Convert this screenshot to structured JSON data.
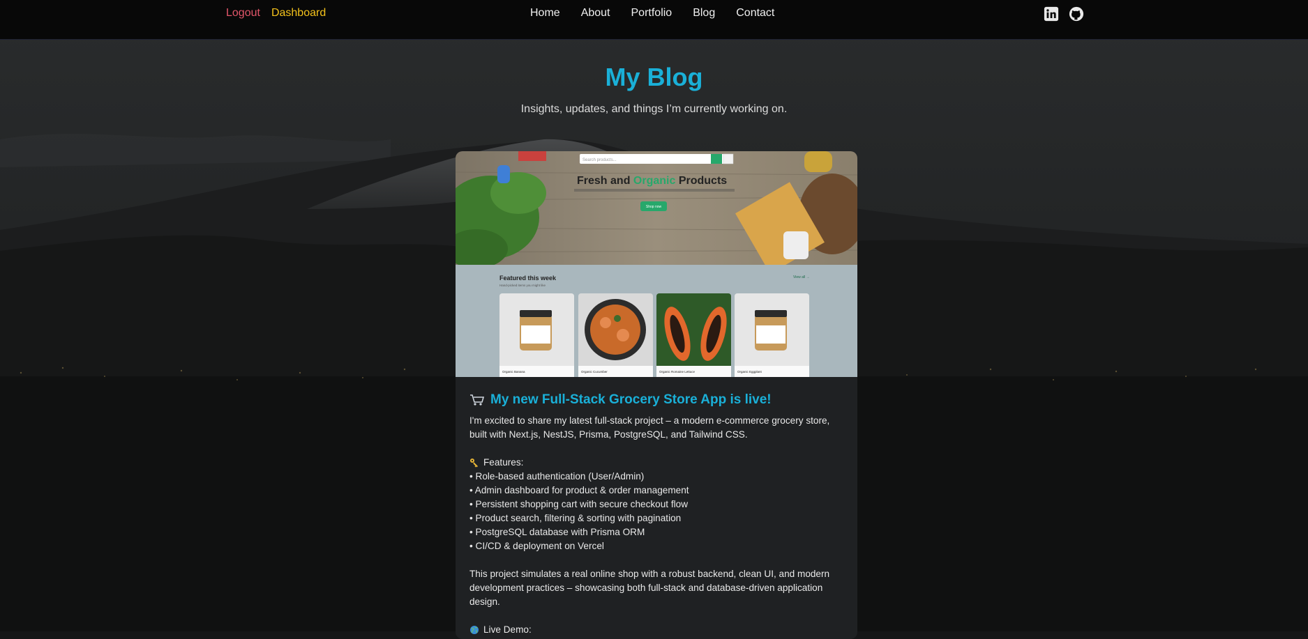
{
  "header": {
    "auth_links": {
      "logout": "Logout",
      "dashboard": "Dashboard"
    },
    "nav": [
      "Home",
      "About",
      "Portfolio",
      "Blog",
      "Contact"
    ],
    "social_icons": [
      "linkedin-icon",
      "github-icon"
    ]
  },
  "page": {
    "title": "My Blog",
    "subtitle": "Insights, updates, and things I’m currently working on."
  },
  "post": {
    "screenshot": {
      "search_placeholder": "Search products...",
      "hero_title_part1": "Fresh and ",
      "hero_title_highlight": "Organic",
      "hero_title_part2": " Products",
      "hero_button": "Shop now",
      "featured_title": "Featured this week",
      "featured_sub": "Hand-picked items you might like",
      "view_all": "View all →",
      "products": [
        "Organic Banana",
        "Organic Cucumber",
        "Organic Romaine Lettuce",
        "Organic Eggplant"
      ]
    },
    "title": "My new Full-Stack Grocery Store App is live!",
    "intro": "I'm excited to share my latest full-stack project – a modern e-commerce grocery store, built with Next.js, NestJS, Prisma, PostgreSQL, and Tailwind CSS.",
    "features_label": "Features:",
    "features": [
      "• Role-based authentication (User/Admin)",
      "• Admin dashboard for product & order management",
      "• Persistent shopping cart with secure checkout flow",
      "• Product search, filtering & sorting with pagination",
      "• PostgreSQL database with Prisma ORM",
      "• CI/CD & deployment on Vercel"
    ],
    "summary": "This project simulates a real online shop with a robust backend, clean UI, and modern development practices – showcasing both full-stack and database-driven application design.",
    "live_demo_label": "Live Demo:"
  },
  "colors": {
    "accent": "#1ab0d8",
    "logout": "#e2566a",
    "dashboard": "#f4c21b"
  }
}
